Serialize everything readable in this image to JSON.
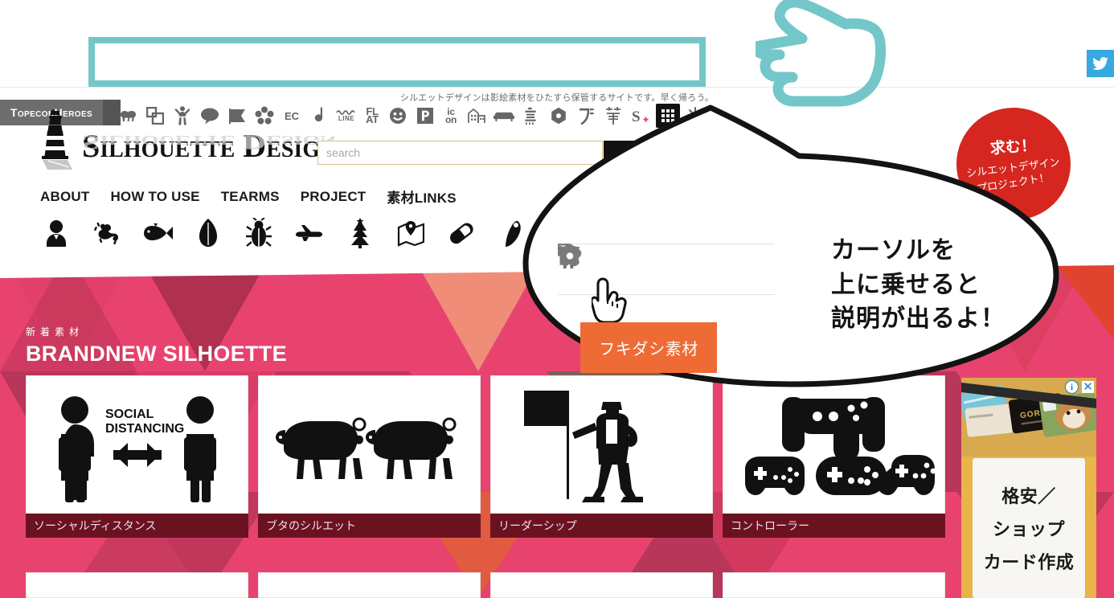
{
  "topbar": {
    "brand_tag": "TopeconHeroes",
    "icons": [
      {
        "name": "sheep-icon",
        "label": ""
      },
      {
        "name": "copy-frames-icon",
        "label": ""
      },
      {
        "name": "cheering-person-icon",
        "label": ""
      },
      {
        "name": "speech-bubble-icon",
        "label": ""
      },
      {
        "name": "flag-pin-icon",
        "label": ""
      },
      {
        "name": "flower-icon",
        "label": ""
      },
      {
        "name": "ec-icon",
        "label": "EC"
      },
      {
        "name": "music-note-icon",
        "label": ""
      },
      {
        "name": "line-icon",
        "label": "LINE"
      },
      {
        "name": "flat-icon",
        "label": "FLAT"
      },
      {
        "name": "smiley-icon",
        "label": ""
      },
      {
        "name": "parking-icon",
        "label": "P"
      },
      {
        "name": "icon-icon",
        "label": "icon"
      },
      {
        "name": "building-icon",
        "label": ""
      },
      {
        "name": "sofa-icon",
        "label": ""
      },
      {
        "name": "bird-kanji-icon",
        "label": ""
      },
      {
        "name": "hexagon-icon",
        "label": ""
      },
      {
        "name": "do-katakana-icon",
        "label": ""
      },
      {
        "name": "brush-kanji-icon",
        "label": ""
      },
      {
        "name": "s-plus-icon",
        "label": "S"
      },
      {
        "name": "grid-icon",
        "label": ""
      },
      {
        "name": "sparkle-icon",
        "label": ""
      }
    ],
    "twitter_label": "twitter-icon"
  },
  "tagline": "シルエットデザインは影絵素材をひたすら保管するサイトです。早く帰ろう。",
  "header": {
    "logo_text": "Silhouette Design",
    "logo_mark": "lighthouse-icon",
    "search_placeholder": "search",
    "search_value": "",
    "search_button_icon": "search-icon",
    "nav": [
      {
        "label": "ABOUT"
      },
      {
        "label": "HOW TO USE"
      },
      {
        "label": "TEARMS"
      },
      {
        "label": "PROJECT"
      },
      {
        "label": "素材LINKS"
      }
    ],
    "categories": [
      {
        "name": "person-icon"
      },
      {
        "name": "lizard-icon"
      },
      {
        "name": "fish-icon"
      },
      {
        "name": "leaf-icon"
      },
      {
        "name": "bug-icon"
      },
      {
        "name": "airplane-icon"
      },
      {
        "name": "christmas-tree-icon"
      },
      {
        "name": "map-pin-icon"
      },
      {
        "name": "capsule-icon"
      },
      {
        "name": "shell-icon"
      }
    ]
  },
  "badge": {
    "line1": "求む！",
    "line2": "シルエットデザイン",
    "line3": "プロジェクト！",
    "color": "#d5271f"
  },
  "hero": {
    "subtitle": "新着素材",
    "title": "BRANDNEW SILHOETTE",
    "cards": [
      {
        "caption": "ソーシャルディスタンス",
        "art": "social-distancing-art",
        "art_text_1": "SOCIAL",
        "art_text_2": "DISTANCING"
      },
      {
        "caption": "ブタのシルエット",
        "art": "pigs-art"
      },
      {
        "caption": "リーダーシップ",
        "art": "leadership-flag-art"
      },
      {
        "caption": "コントローラー",
        "art": "game-controllers-art"
      }
    ]
  },
  "ad": {
    "line1": "格安／",
    "line2": "ショップ",
    "line3": "カード作成",
    "info_label": "i",
    "close_label": "✕",
    "photo_text": "GORGEOUS"
  },
  "callout": {
    "icons": [
      {
        "name": "copy-frames-icon"
      },
      {
        "name": "cheering-person-icon"
      },
      {
        "name": "speech-bubble-icon"
      },
      {
        "name": "flag-pin-icon"
      },
      {
        "name": "flower-icon"
      }
    ],
    "tooltip": "フキダシ素材",
    "tooltip_color": "#ef6b35",
    "text_line1": "カーソルを",
    "text_line2": "上に乗せると",
    "text_line3": "説明が出るよ！",
    "cursor": "pointing-hand-cursor"
  },
  "annotation": {
    "highlight_color": "#74c7c8",
    "hand": "pointing-hand-annotation"
  }
}
